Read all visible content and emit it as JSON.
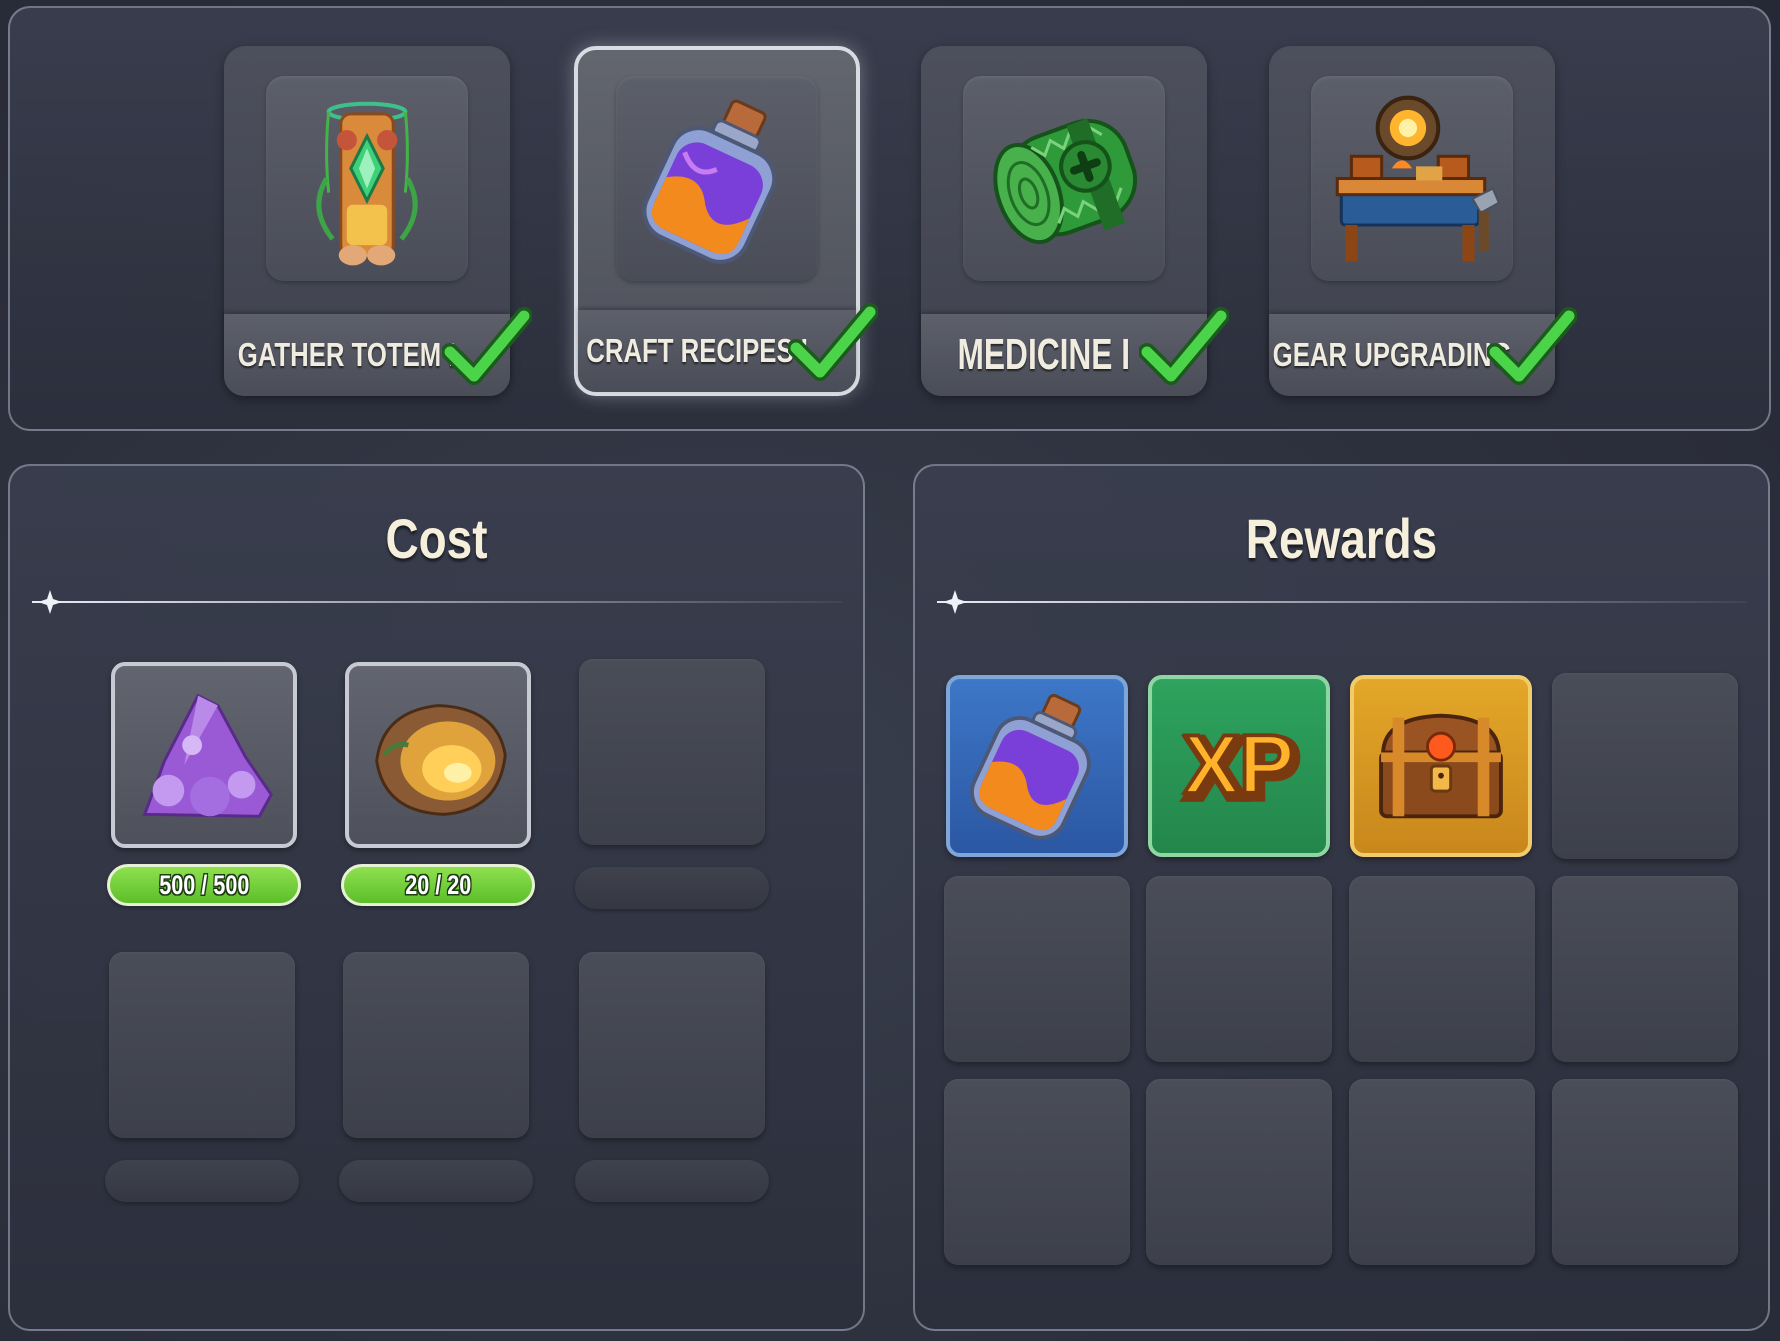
{
  "research": [
    {
      "label": "GATHER TOTEM I",
      "icon": "totem-icon",
      "completed": true,
      "selected": false
    },
    {
      "label": "CRAFT RECIPES I",
      "icon": "potion-icon",
      "completed": true,
      "selected": true
    },
    {
      "label": "MEDICINE I",
      "icon": "bandage-roll-icon",
      "completed": true,
      "selected": false
    },
    {
      "label": "GEAR UPGRADING",
      "icon": "workbench-icon",
      "completed": true,
      "selected": false
    }
  ],
  "cost": {
    "title": "Cost",
    "items": [
      {
        "icon": "amethyst-ore-icon",
        "quantity": "500 / 500"
      },
      {
        "icon": "amber-stone-icon",
        "quantity": "20 / 20"
      }
    ]
  },
  "rewards": {
    "title": "Rewards",
    "items": [
      {
        "icon": "potion-icon",
        "rarity": "blue"
      },
      {
        "icon": "xp-icon",
        "text": "XP",
        "rarity": "green"
      },
      {
        "icon": "treasure-chest-icon",
        "rarity": "gold"
      }
    ]
  },
  "colors": {
    "complete_check": "#4bd34a",
    "quantity_full": "#74d23a"
  }
}
